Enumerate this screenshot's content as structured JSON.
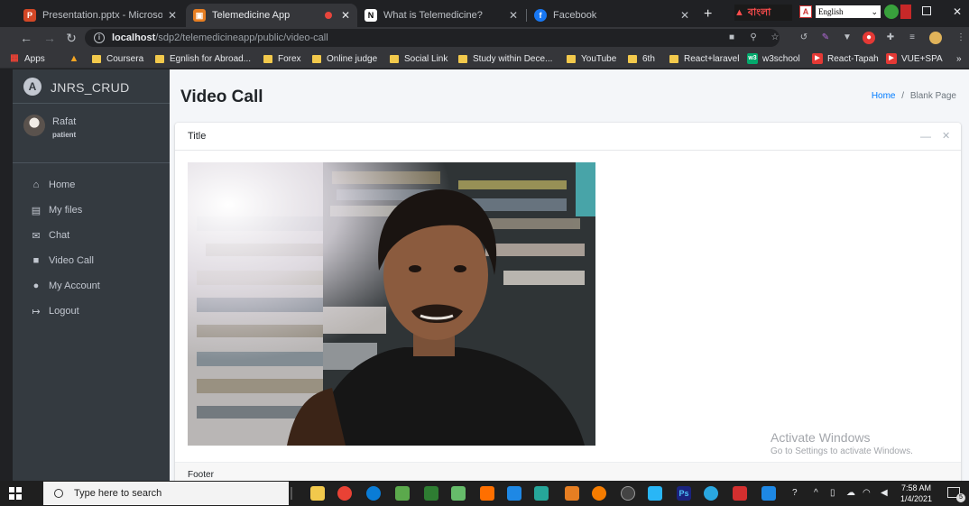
{
  "browser": {
    "tabs": [
      {
        "title": "Presentation.pptx - Microsoft Po",
        "icon": "powerpoint-icon",
        "color": "#d24726",
        "glyph": "P"
      },
      {
        "title": "Telemedicine App",
        "icon": "app-favicon",
        "color": "#e67e22",
        "glyph": "▣"
      },
      {
        "title": "What is Telemedicine?",
        "icon": "notion-icon",
        "color": "#ffffff",
        "glyph": "N"
      },
      {
        "title": "Facebook",
        "icon": "facebook-icon",
        "color": "#1877f2",
        "glyph": "f"
      }
    ],
    "new_tab": "+",
    "close_glyph": "✕",
    "extension_text": "বাংলা",
    "language_select": "English",
    "address": {
      "host": "localhost",
      "path": "/sdp2/telemedicineapp/public/video-call"
    },
    "bookmarks": [
      {
        "label": "Apps",
        "icon": "apps-grid-icon"
      },
      {
        "label": "",
        "icon": "bookmark-logo-icon"
      },
      {
        "label": "Coursera",
        "icon": "folder-icon"
      },
      {
        "label": "Egnlish for Abroad...",
        "icon": "folder-icon"
      },
      {
        "label": "Forex",
        "icon": "folder-icon"
      },
      {
        "label": "Online judge",
        "icon": "folder-icon"
      },
      {
        "label": "Social Link",
        "icon": "folder-icon"
      },
      {
        "label": "Study within Dece...",
        "icon": "folder-icon"
      },
      {
        "label": "YouTube",
        "icon": "folder-icon"
      },
      {
        "label": "6th",
        "icon": "folder-icon"
      },
      {
        "label": "React+laravel",
        "icon": "folder-icon"
      },
      {
        "label": "w3school",
        "icon": "w3-icon"
      },
      {
        "label": "React-Tapah",
        "icon": "youtube-icon"
      },
      {
        "label": "VUE+SPA",
        "icon": "youtube-icon"
      }
    ],
    "more_bookmarks": "»"
  },
  "sidebar": {
    "brand": "JNRS_CRUD",
    "brand_glyph": "A",
    "user_name": "Rafat",
    "user_role": "patient",
    "items": [
      {
        "label": "Home",
        "icon": "home-icon",
        "glyph": "⌂"
      },
      {
        "label": "My files",
        "icon": "file-icon",
        "glyph": "▤"
      },
      {
        "label": "Chat",
        "icon": "chat-icon",
        "glyph": "✉"
      },
      {
        "label": "Video Call",
        "icon": "video-camera-icon",
        "glyph": "■"
      },
      {
        "label": "My Account",
        "icon": "user-circle-icon",
        "glyph": "●"
      },
      {
        "label": "Logout",
        "icon": "sign-out-icon",
        "glyph": "↦"
      }
    ]
  },
  "content": {
    "page_title": "Video Call",
    "breadcrumb": {
      "home": "Home",
      "separator": "/",
      "current": "Blank Page"
    },
    "card": {
      "title": "Title",
      "collapse_glyph": "—",
      "remove_glyph": "✕",
      "footer": "Footer"
    }
  },
  "watermark": {
    "line1": "Activate Windows",
    "line2": "Go to Settings to activate Windows."
  },
  "taskbar": {
    "search_placeholder": "Type here to search",
    "time": "7:58 AM",
    "date": "1/4/2021",
    "notification_count": "5"
  },
  "colors": {
    "sidebar": "#343a40",
    "accent": "#007bff",
    "page_bg": "#f4f6f9"
  }
}
